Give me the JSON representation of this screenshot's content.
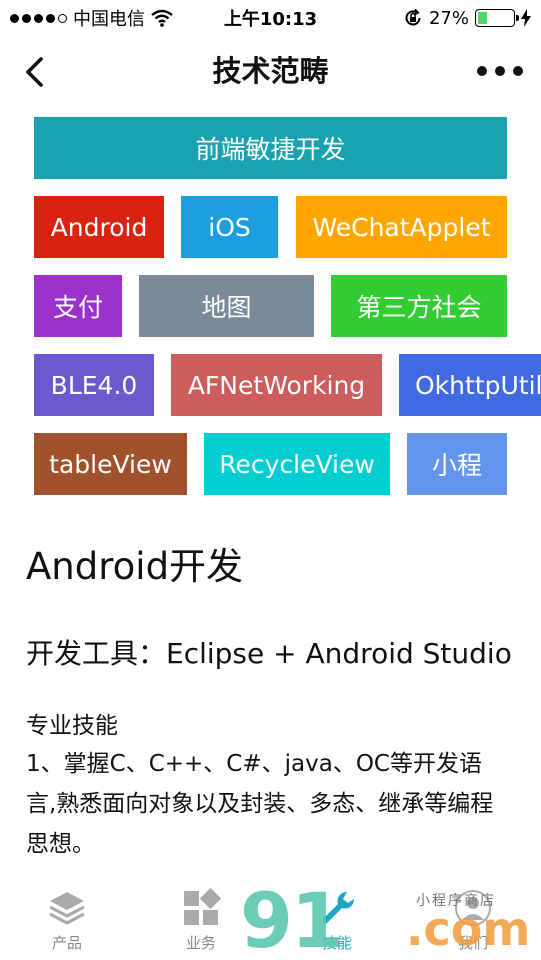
{
  "status_bar": {
    "carrier": "中国电信",
    "time": "上午10:13",
    "battery_percent_text": "27%",
    "battery_level": 0.27
  },
  "nav": {
    "title": "技术范畴"
  },
  "tags": [
    {
      "label": "前端敏捷开发",
      "color": "#1aa3ae"
    },
    {
      "label": "Android",
      "color": "#d9220f"
    },
    {
      "label": "iOS",
      "color": "#1e9ede"
    },
    {
      "label": "WeChatApplet",
      "color": "#ffa600"
    },
    {
      "label": "支付",
      "color": "#9c31cc"
    },
    {
      "label": "地图",
      "color": "#7a8a99"
    },
    {
      "label": "第三方社会",
      "color": "#33cc33"
    },
    {
      "label": "BLE4.0",
      "color": "#6a5acd"
    },
    {
      "label": "AFNetWorking",
      "color": "#cd5c5c"
    },
    {
      "label": "OkhttpUtils",
      "color": "#4169e1"
    },
    {
      "label": "tableView",
      "color": "#a0522d"
    },
    {
      "label": "RecycleView",
      "color": "#00ced1"
    },
    {
      "label": "小程",
      "color": "#6495ed"
    }
  ],
  "content": {
    "title": "Android开发",
    "tools": "开发工具：Eclipse + Android Studio",
    "skills_heading": "专业技能",
    "skills_text": "1、掌握C、C++、C#、java、OC等开发语言,熟悉面向对象以及封装、多态、继承等编程思想。"
  },
  "tab_bar": {
    "items": [
      {
        "label": "产品",
        "icon": "layers-icon"
      },
      {
        "label": "业务",
        "icon": "grid-icon"
      },
      {
        "label": "技能",
        "icon": "wrench-icon",
        "active": true
      },
      {
        "label": "我们",
        "icon": "user-icon"
      }
    ]
  },
  "watermark": {
    "brand": "91",
    "suffix": ".com",
    "slogan": "小程序商店"
  }
}
